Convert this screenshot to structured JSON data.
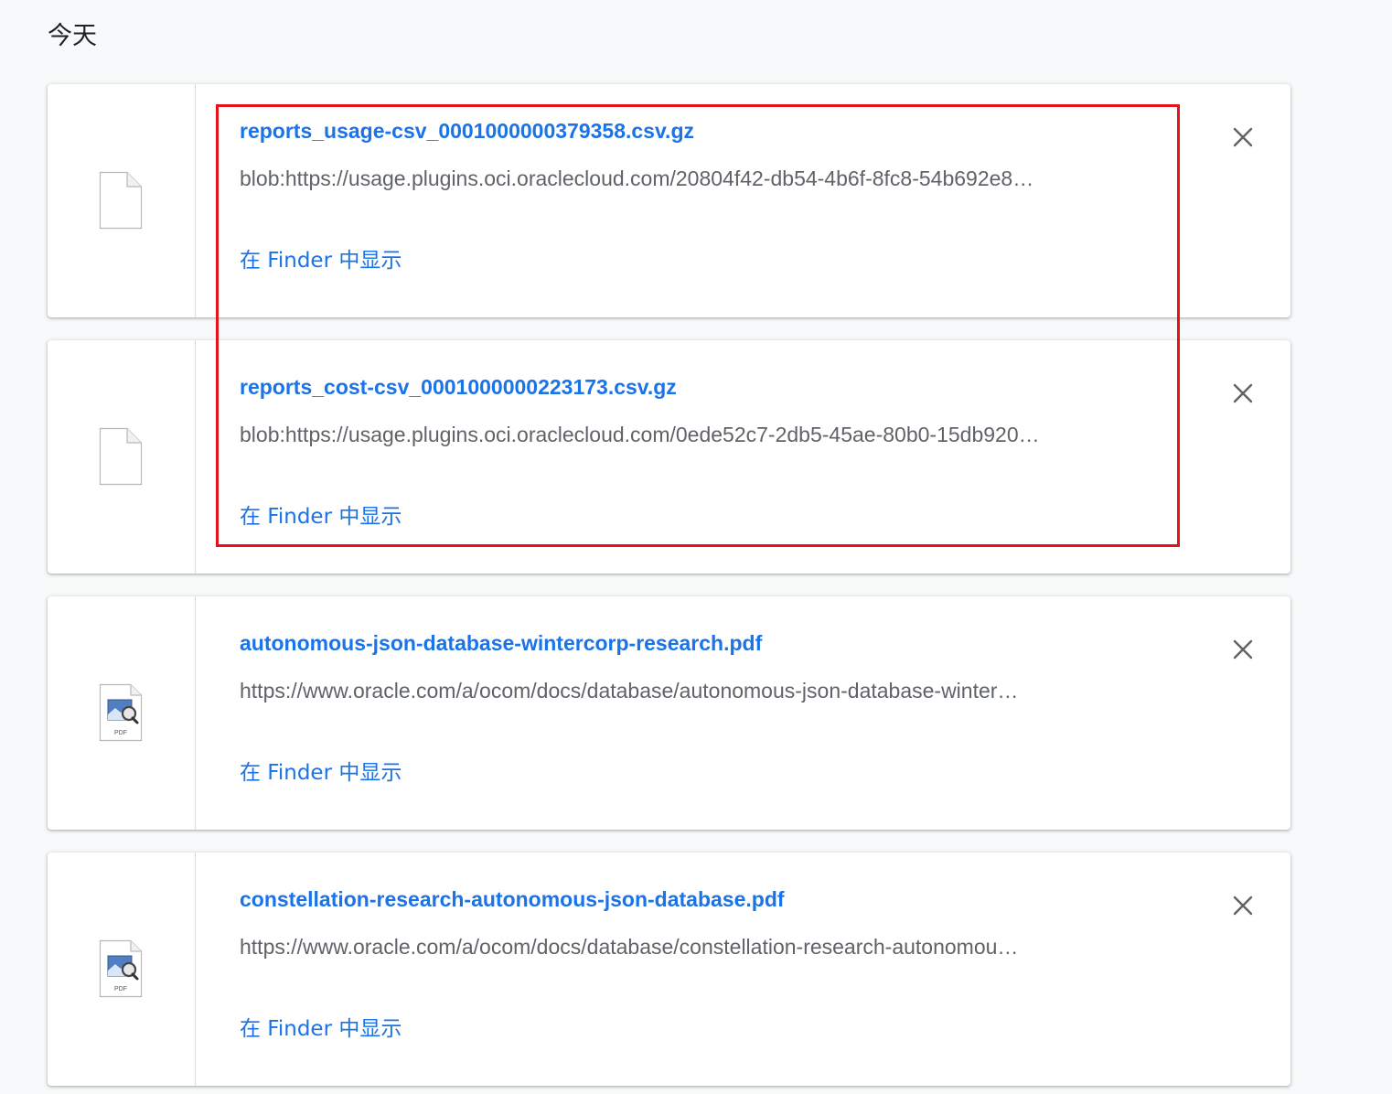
{
  "section": {
    "title": "今天"
  },
  "downloads": [
    {
      "file_name": "reports_usage-csv_0001000000379358.csv.gz",
      "url": "blob:https://usage.plugins.oci.oraclecloud.com/20804f42-db54-4b6f-8fc8-54b692e8…",
      "action_label": "在 Finder 中显示",
      "icon": "generic-file-icon",
      "close_icon": "close-icon"
    },
    {
      "file_name": "reports_cost-csv_0001000000223173.csv.gz",
      "url": "blob:https://usage.plugins.oci.oraclecloud.com/0ede52c7-2db5-45ae-80b0-15db920…",
      "action_label": "在 Finder 中显示",
      "icon": "generic-file-icon",
      "close_icon": "close-icon"
    },
    {
      "file_name": "autonomous-json-database-wintercorp-research.pdf",
      "url": "https://www.oracle.com/a/ocom/docs/database/autonomous-json-database-winter…",
      "action_label": "在 Finder 中显示",
      "icon": "pdf-file-icon",
      "icon_label": "PDF",
      "close_icon": "close-icon"
    },
    {
      "file_name": "constellation-research-autonomous-json-database.pdf",
      "url": "https://www.oracle.com/a/ocom/docs/database/constellation-research-autonomou…",
      "action_label": "在 Finder 中显示",
      "icon": "pdf-file-icon",
      "icon_label": "PDF",
      "close_icon": "close-icon"
    }
  ],
  "colors": {
    "link": "#1a73e8",
    "secondary_text": "#5f6368",
    "highlight": "#e6121b",
    "background": "#f8f9fa"
  }
}
